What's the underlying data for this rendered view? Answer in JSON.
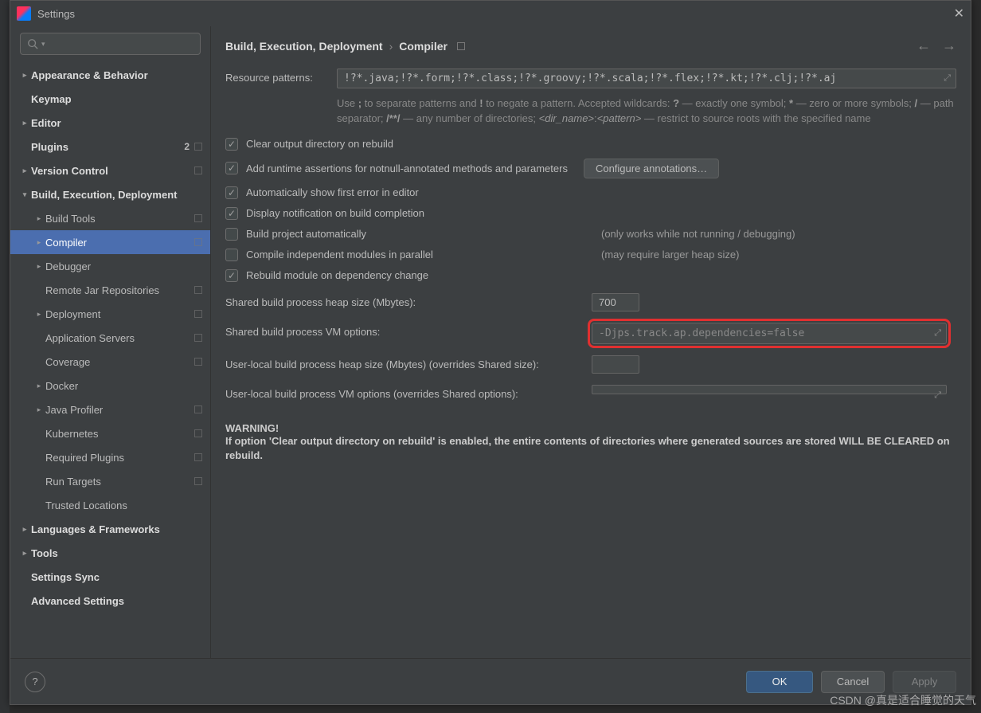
{
  "window": {
    "title": "Settings"
  },
  "sidebar": {
    "items": [
      {
        "label": "Appearance & Behavior",
        "bold": true,
        "arrow": ">",
        "lvl": 0
      },
      {
        "label": "Keymap",
        "bold": true,
        "lvl": 0
      },
      {
        "label": "Editor",
        "bold": true,
        "arrow": ">",
        "lvl": 0
      },
      {
        "label": "Plugins",
        "bold": true,
        "lvl": 0,
        "badge": "2",
        "sq": true
      },
      {
        "label": "Version Control",
        "bold": true,
        "arrow": ">",
        "lvl": 0,
        "sq": true
      },
      {
        "label": "Build, Execution, Deployment",
        "bold": true,
        "arrow": "v",
        "lvl": 0
      },
      {
        "label": "Build Tools",
        "arrow": ">",
        "lvl": 1,
        "sq": true
      },
      {
        "label": "Compiler",
        "arrow": ">",
        "lvl": 1,
        "sq": true,
        "selected": true
      },
      {
        "label": "Debugger",
        "arrow": ">",
        "lvl": 1
      },
      {
        "label": "Remote Jar Repositories",
        "lvl": 1,
        "sq": true
      },
      {
        "label": "Deployment",
        "arrow": ">",
        "lvl": 1,
        "sq": true
      },
      {
        "label": "Application Servers",
        "lvl": 1,
        "sq": true
      },
      {
        "label": "Coverage",
        "lvl": 1,
        "sq": true
      },
      {
        "label": "Docker",
        "arrow": ">",
        "lvl": 1
      },
      {
        "label": "Java Profiler",
        "arrow": ">",
        "lvl": 1,
        "sq": true
      },
      {
        "label": "Kubernetes",
        "lvl": 1,
        "sq": true
      },
      {
        "label": "Required Plugins",
        "lvl": 1,
        "sq": true
      },
      {
        "label": "Run Targets",
        "lvl": 1,
        "sq": true
      },
      {
        "label": "Trusted Locations",
        "lvl": 1
      },
      {
        "label": "Languages & Frameworks",
        "bold": true,
        "arrow": ">",
        "lvl": 0
      },
      {
        "label": "Tools",
        "bold": true,
        "arrow": ">",
        "lvl": 0
      },
      {
        "label": "Settings Sync",
        "bold": true,
        "lvl": 0
      },
      {
        "label": "Advanced Settings",
        "bold": true,
        "lvl": 0
      }
    ]
  },
  "breadcrumb": {
    "a": "Build, Execution, Deployment",
    "b": "Compiler"
  },
  "form": {
    "resource_label": "Resource patterns:",
    "resource_value": "!?*.java;!?*.form;!?*.class;!?*.groovy;!?*.scala;!?*.flex;!?*.kt;!?*.clj;!?*.aj",
    "help_html": "Use <b>;</b> to separate patterns and <b>!</b> to negate a pattern. Accepted wildcards: <b>?</b> — exactly one symbol; <b>*</b> — zero or more symbols; <b>/</b> — path separator; <b>/**/</b> — any number of directories; <i>&lt;dir_name&gt;</i>:<i>&lt;pattern&gt;</i> — restrict to source roots with the specified name",
    "chk_clear": "Clear output directory on rebuild",
    "chk_assert": "Add runtime assertions for notnull-annotated methods and parameters",
    "btn_configure": "Configure annotations…",
    "chk_auto_err": "Automatically show first error in editor",
    "chk_notify": "Display notification on build completion",
    "chk_build_auto": "Build project automatically",
    "chk_build_auto_note": "(only works while not running / debugging)",
    "chk_parallel": "Compile independent modules in parallel",
    "chk_parallel_note": "(may require larger heap size)",
    "chk_rebuild_dep": "Rebuild module on dependency change",
    "shared_heap_label": "Shared build process heap size (Mbytes):",
    "shared_heap_value": "700",
    "shared_vm_label": "Shared build process VM options:",
    "shared_vm_value": "-Djps.track.ap.dependencies=false",
    "user_heap_label": "User-local build process heap size (Mbytes) (overrides Shared size):",
    "user_heap_value": "",
    "user_vm_label": "User-local build process VM options (overrides Shared options):",
    "user_vm_value": "",
    "warning_title": "WARNING!",
    "warning_body": "If option 'Clear output directory on rebuild' is enabled, the entire contents of directories where generated sources are stored WILL BE CLEARED on rebuild."
  },
  "footer": {
    "ok": "OK",
    "cancel": "Cancel",
    "apply": "Apply"
  },
  "watermark": "CSDN @真是适合睡觉的天气"
}
